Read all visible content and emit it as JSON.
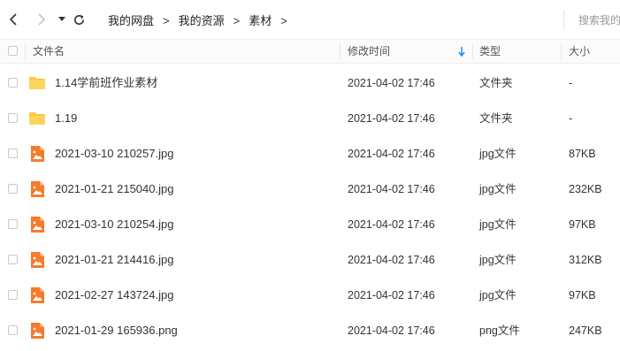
{
  "breadcrumb": [
    "我的网盘",
    "我的资源",
    "素材"
  ],
  "breadcrumb_separator": ">",
  "search": {
    "placeholder": "搜索我的文件"
  },
  "columns": {
    "name": "文件名",
    "modified": "修改时间",
    "type": "类型",
    "size": "大小"
  },
  "colors": {
    "folder": "#ffc83d",
    "image_file": "#f57b2c",
    "sort_arrow": "#1f8ceb"
  },
  "files": [
    {
      "name": "1.14学前班作业素材",
      "modified": "2021-04-02 17:46",
      "type": "文件夹",
      "size": "-",
      "icon": "folder-icon"
    },
    {
      "name": "1.19",
      "modified": "2021-04-02 17:46",
      "type": "文件夹",
      "size": "-",
      "icon": "folder-icon"
    },
    {
      "name": "2021-03-10 210257.jpg",
      "modified": "2021-04-02 17:46",
      "type": "jpg文件",
      "size": "87KB",
      "icon": "image-file-icon"
    },
    {
      "name": "2021-01-21 215040.jpg",
      "modified": "2021-04-02 17:46",
      "type": "jpg文件",
      "size": "232KB",
      "icon": "image-file-icon"
    },
    {
      "name": "2021-03-10 210254.jpg",
      "modified": "2021-04-02 17:46",
      "type": "jpg文件",
      "size": "97KB",
      "icon": "image-file-icon"
    },
    {
      "name": "2021-01-21 214416.jpg",
      "modified": "2021-04-02 17:46",
      "type": "jpg文件",
      "size": "312KB",
      "icon": "image-file-icon"
    },
    {
      "name": "2021-02-27 143724.jpg",
      "modified": "2021-04-02 17:46",
      "type": "jpg文件",
      "size": "97KB",
      "icon": "image-file-icon"
    },
    {
      "name": "2021-01-29 165936.png",
      "modified": "2021-04-02 17:46",
      "type": "png文件",
      "size": "247KB",
      "icon": "image-file-icon"
    }
  ]
}
